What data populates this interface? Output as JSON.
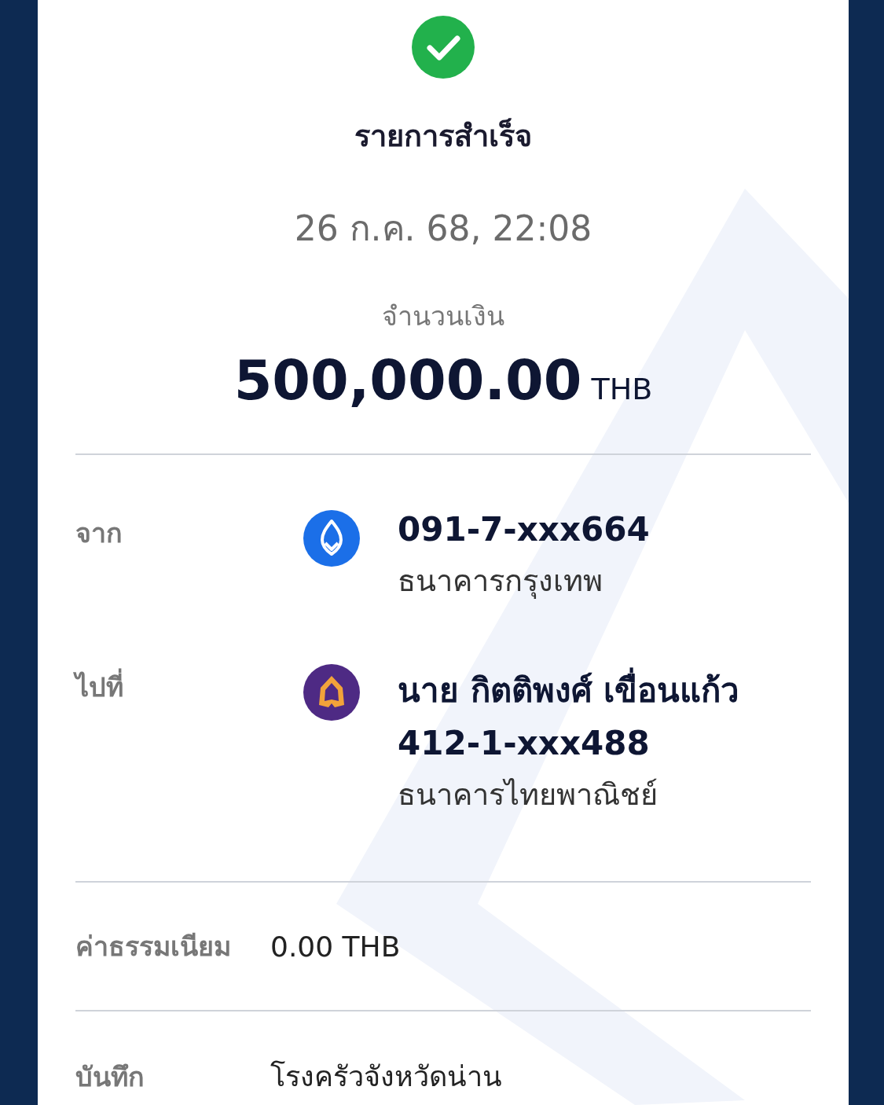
{
  "status": {
    "title": "รายการสำเร็จ",
    "datetime": "26 ก.ค. 68, 22:08"
  },
  "amount": {
    "label": "จำนวนเงิน",
    "value": "500,000.00",
    "currency": "THB"
  },
  "parties": [
    {
      "label": "จาก",
      "kind": "leaf",
      "lines": [
        {
          "text": "091-7-xxx664",
          "kind": "strong"
        },
        {
          "text": "ธนาคารกรุงเทพ",
          "kind": "plain"
        }
      ]
    },
    {
      "label": "ไปที่",
      "kind": "arch",
      "lines": [
        {
          "text": "นาย กิตติพงศ์ เขื่อนแก้ว",
          "kind": "strong"
        },
        {
          "text": "412-1-xxx488",
          "kind": "strong"
        },
        {
          "text": "ธนาคารไทยพาณิชย์",
          "kind": "plain"
        }
      ]
    }
  ],
  "details": [
    {
      "label": "ค่าธรรมเนียม",
      "value": "0.00 THB"
    },
    {
      "label": "บันทึก",
      "value": "โรงครัวจังหวัดน่าน"
    }
  ]
}
